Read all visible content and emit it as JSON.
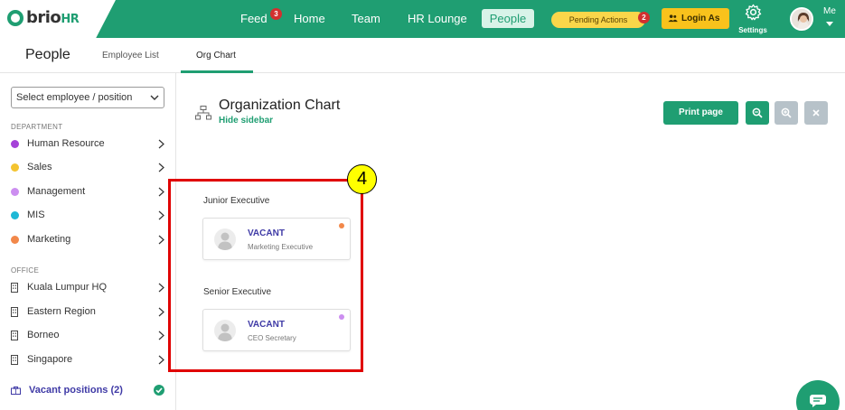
{
  "brand": {
    "name": "brio",
    "suffix": "HR"
  },
  "nav": {
    "feed": "Feed",
    "feed_badge": "3",
    "home": "Home",
    "team": "Team",
    "hr_lounge": "HR Lounge",
    "people": "People",
    "pending_actions": "Pending Actions",
    "pending_badge": "2",
    "login_as": "Login As",
    "settings": "Settings",
    "me": "Me"
  },
  "subheader": {
    "title": "People",
    "tabs": [
      {
        "label": "Employee List",
        "active": false
      },
      {
        "label": "Org Chart",
        "active": true
      }
    ]
  },
  "sidebar": {
    "select_placeholder": "Select employee / position",
    "department_label": "DEPARTMENT",
    "departments": [
      {
        "label": "Human Resource",
        "color": "#a542d8"
      },
      {
        "label": "Sales",
        "color": "#f4c430"
      },
      {
        "label": "Management",
        "color": "#cc8ef0"
      },
      {
        "label": "MIS",
        "color": "#1eb8d6"
      },
      {
        "label": "Marketing",
        "color": "#f2884a"
      }
    ],
    "office_label": "OFFICE",
    "offices": [
      {
        "label": "Kuala Lumpur HQ"
      },
      {
        "label": "Eastern Region"
      },
      {
        "label": "Borneo"
      },
      {
        "label": "Singapore"
      }
    ],
    "vacant_positions": "Vacant positions (2)"
  },
  "main": {
    "title": "Organization Chart",
    "hide_sidebar": "Hide sidebar",
    "print_label": "Print page",
    "step_number": "4",
    "groups": [
      {
        "label": "Junior Executive",
        "card": {
          "name": "VACANT",
          "role": "Marketing Executive",
          "status_color": "#f2884a"
        }
      },
      {
        "label": "Senior Executive",
        "card": {
          "name": "VACANT",
          "role": "CEO Secretary",
          "status_color": "#cc8ef0"
        }
      }
    ]
  },
  "colors": {
    "brand_green": "#1f9e72",
    "link_purple": "#3f3aa6",
    "highlight_red": "#e00000"
  }
}
